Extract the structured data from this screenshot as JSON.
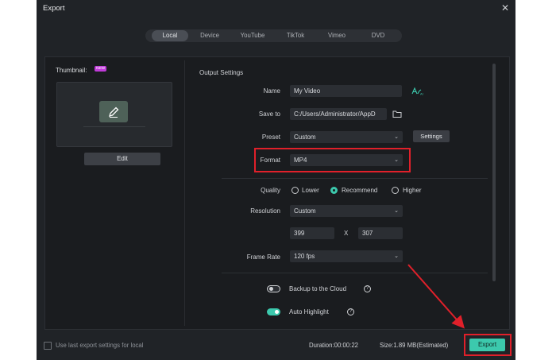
{
  "window": {
    "title": "Export"
  },
  "tabs": [
    "Local",
    "Device",
    "YouTube",
    "TikTok",
    "Vimeo",
    "DVD"
  ],
  "thumbnail": {
    "label": "Thumbnail:",
    "badge": "NEW",
    "edit_label": "Edit"
  },
  "output": {
    "section_title": "Output Settings",
    "name_label": "Name",
    "name_value": "My Video",
    "save_label": "Save to",
    "save_value": "C:/Users/Administrator/AppD",
    "preset_label": "Preset",
    "preset_value": "Custom",
    "settings_button": "Settings",
    "format_label": "Format",
    "format_value": "MP4",
    "quality_label": "Quality",
    "quality_options": [
      "Lower",
      "Recommend",
      "Higher"
    ],
    "quality_selected": "Recommend",
    "resolution_label": "Resolution",
    "resolution_value": "Custom",
    "width_value": "399",
    "x_label": "X",
    "height_value": "307",
    "framerate_label": "Frame Rate",
    "framerate_value": "120 fps",
    "backup_label": "Backup to the Cloud",
    "backup_on": false,
    "autohighlight_label": "Auto Highlight",
    "autohighlight_on": true
  },
  "footer": {
    "checkbox_label": "Use last export settings for local",
    "duration": "Duration:00:00:22",
    "size": "Size:1.89 MB(Estimated)",
    "export_button": "Export"
  },
  "colors": {
    "accent": "#3cc9ad",
    "annotation": "#e0202a",
    "background": "#202327"
  }
}
